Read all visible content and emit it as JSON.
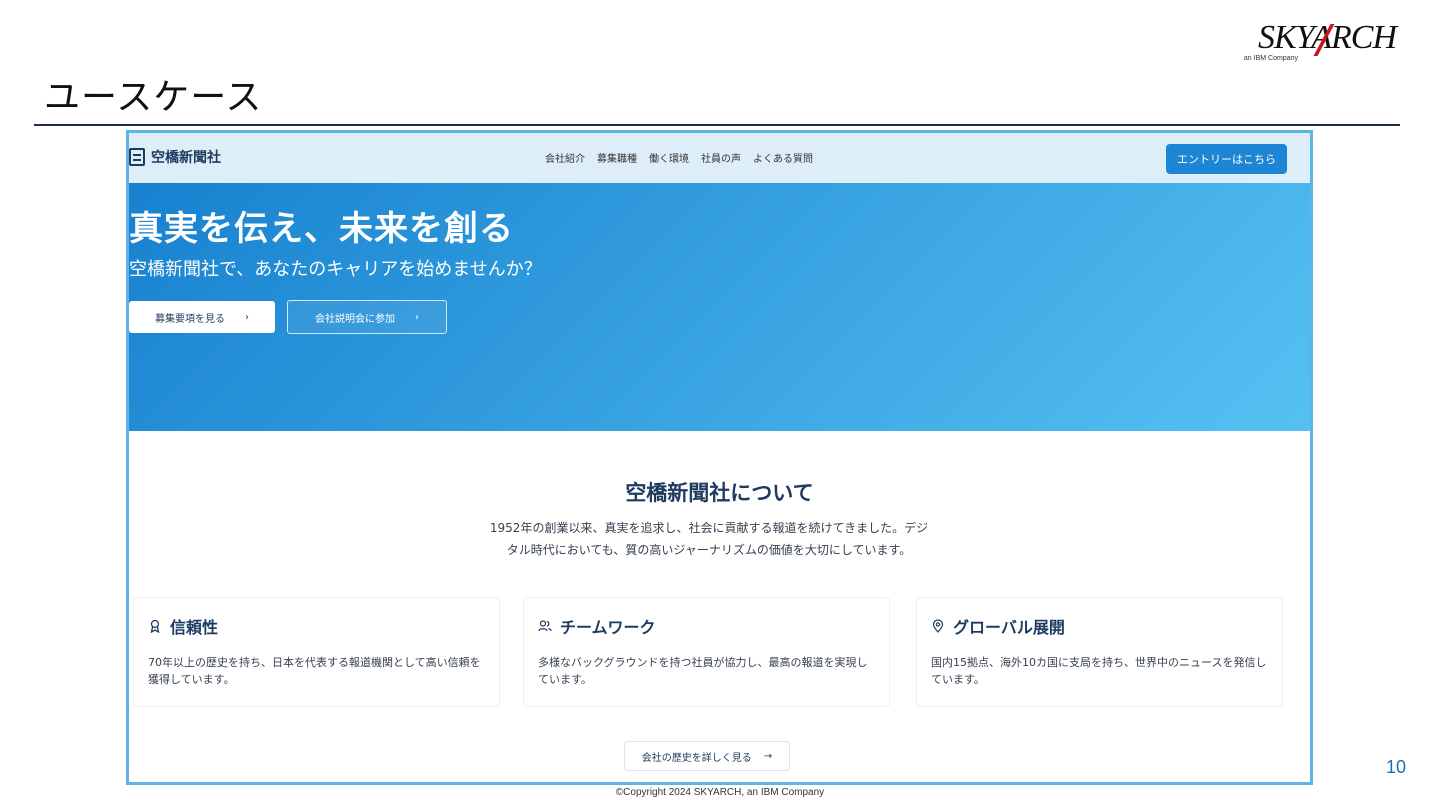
{
  "slide": {
    "title": "ユースケース",
    "logo_text": "SKYARCH",
    "logo_subtext": "an IBM Company",
    "page_number": "10",
    "copyright": "©Copyright 2024 SKYARCH, an IBM Company"
  },
  "site": {
    "brand_name": "空橋新聞社",
    "nav_links": [
      "会社紹介",
      "募集職種",
      "働く環境",
      "社員の声",
      "よくある質問"
    ],
    "entry_button": "エントリーはこちら"
  },
  "hero": {
    "title": "真実を伝え、未来を創る",
    "subtitle": "空橋新聞社で、あなたのキャリアを始めませんか？",
    "primary_button": "募集要項を見る",
    "secondary_button": "会社説明会に参加",
    "chevron": "›"
  },
  "about": {
    "title": "空橋新聞社について",
    "description_line1": "1952年の創業以来、真実を追求し、社会に貢献する報道を続けてきました。デジ",
    "description_line2": "タル時代においても、質の高いジャーナリズムの価値を大切にしています。",
    "cards": [
      {
        "icon": "award-icon",
        "title": "信頼性",
        "text": "70年以上の歴史を持ち、日本を代表する報道機関として高い信頼を獲得しています。"
      },
      {
        "icon": "users-icon",
        "title": "チームワーク",
        "text": "多様なバックグラウンドを持つ社員が協力し、最高の報道を実現しています。"
      },
      {
        "icon": "map-pin-icon",
        "title": "グローバル展開",
        "text": "国内15拠点、海外10カ国に支局を持ち、世界中のニュースを発信しています。"
      }
    ],
    "history_button": "会社の歴史を詳しく見る",
    "arrow": "→"
  },
  "colors": {
    "accent": "#1d86d4",
    "navy": "#1e3a5f",
    "frame": "#5db4e5",
    "nav_bg": "#ddeef8"
  }
}
